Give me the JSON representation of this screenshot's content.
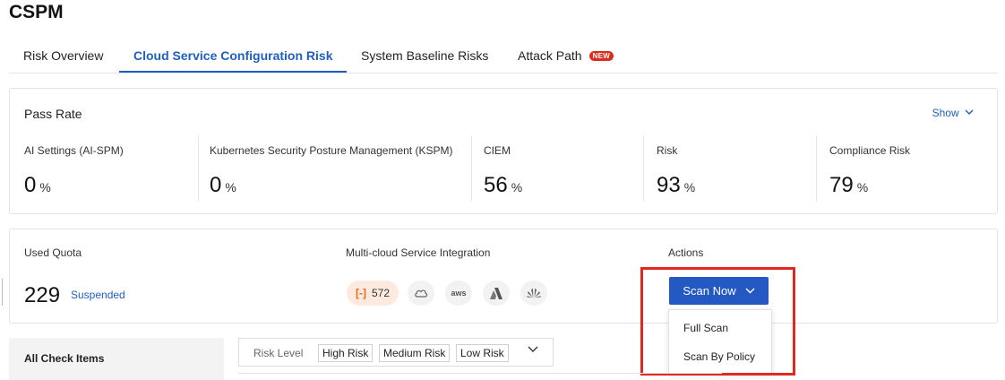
{
  "app": {
    "title": "CSPM"
  },
  "tabs": [
    {
      "label": "Risk Overview"
    },
    {
      "label": "Cloud Service Configuration Risk",
      "active": true
    },
    {
      "label": "System Baseline Risks"
    },
    {
      "label": "Attack Path",
      "badge": "NEW"
    }
  ],
  "pass_rate": {
    "title": "Pass Rate",
    "show_label": "Show",
    "metrics": [
      {
        "label": "AI Settings (AI-SPM)",
        "value": "0",
        "unit": "%"
      },
      {
        "label": "Kubernetes Security Posture Management (KSPM)",
        "value": "0",
        "unit": "%"
      },
      {
        "label": "CIEM",
        "value": "56",
        "unit": "%"
      },
      {
        "label": "Risk",
        "value": "93",
        "unit": "%"
      },
      {
        "label": "Compliance Risk",
        "value": "79",
        "unit": "%"
      }
    ]
  },
  "quota": {
    "label": "Used Quota",
    "value": "229",
    "status": "Suspended"
  },
  "integration": {
    "label": "Multi-cloud Service Integration",
    "providers": [
      {
        "icon": "alibaba-cloud-icon",
        "count": "572"
      },
      {
        "icon": "cloud-icon"
      },
      {
        "icon": "aws-icon",
        "text": "aws"
      },
      {
        "icon": "azure-icon"
      },
      {
        "icon": "huawei-icon"
      }
    ]
  },
  "actions": {
    "label": "Actions",
    "scan_button": "Scan Now",
    "menu": [
      "Full Scan",
      "Scan By Policy"
    ]
  },
  "sidebar": {
    "all_items": "All Check Items"
  },
  "filter": {
    "label": "Risk Level",
    "tags": [
      "High Risk",
      "Medium Risk",
      "Low Risk"
    ]
  },
  "colors": {
    "accent": "#1f5fbf",
    "primary_button": "#2459c4",
    "badge": "#d92d20",
    "highlight": "#e3291f"
  }
}
